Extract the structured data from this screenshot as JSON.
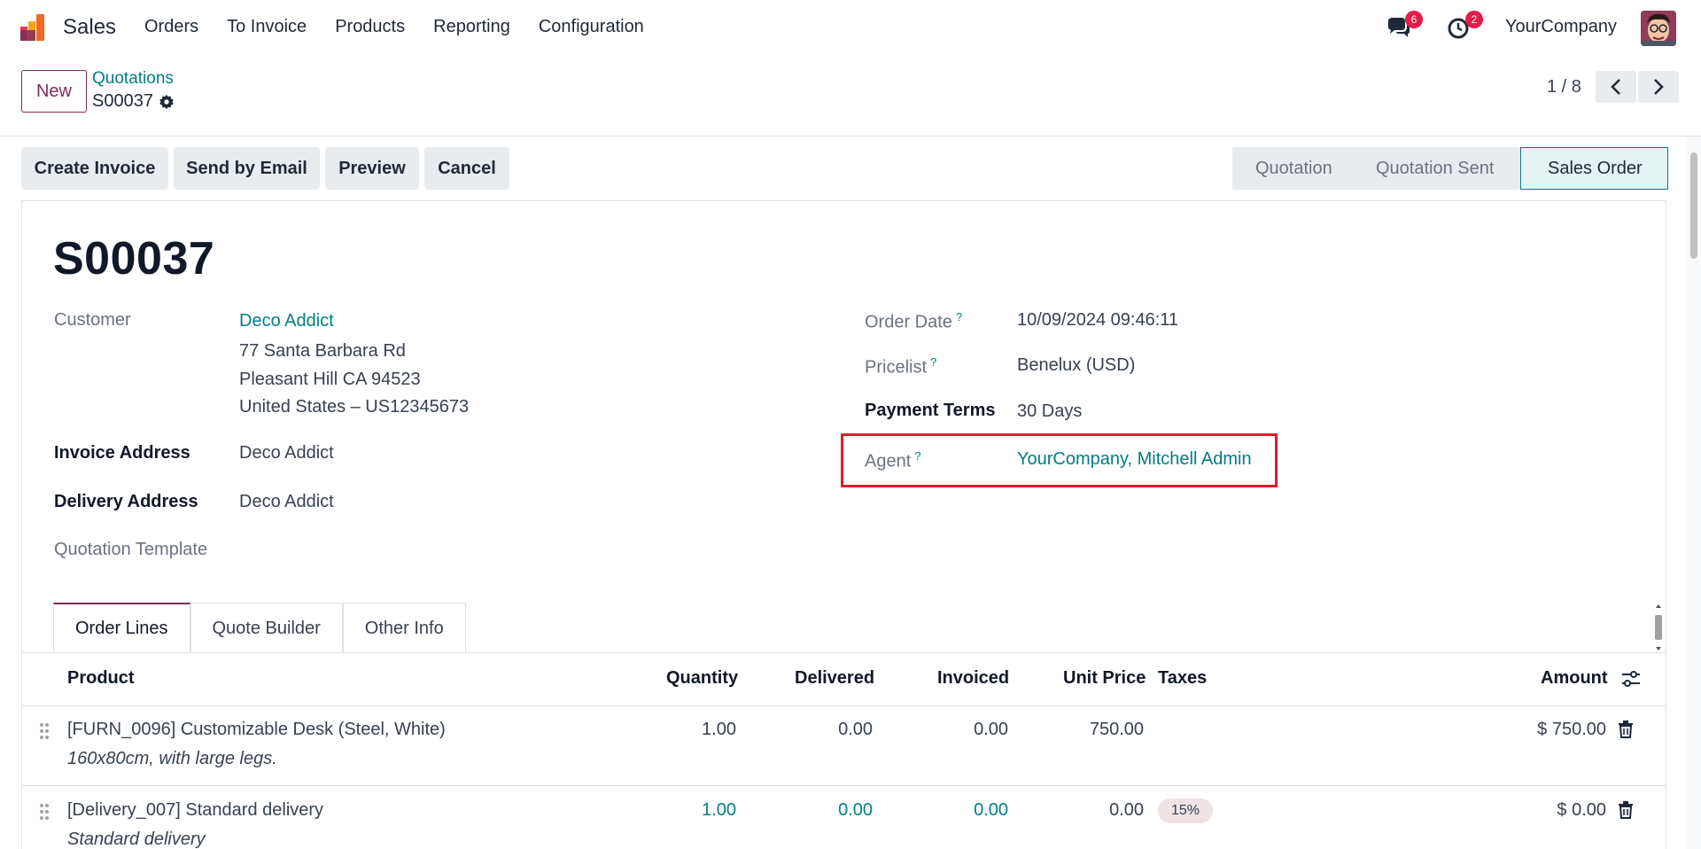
{
  "navbar": {
    "app_name": "Sales",
    "menu": [
      "Orders",
      "To Invoice",
      "Products",
      "Reporting",
      "Configuration"
    ],
    "messages_count": "6",
    "activities_count": "2",
    "company": "YourCompany"
  },
  "control": {
    "new_label": "New",
    "breadcrumb_parent": "Quotations",
    "breadcrumb_current": "S00037",
    "pager": "1 / 8"
  },
  "actions": {
    "create_invoice": "Create Invoice",
    "send_email": "Send by Email",
    "preview": "Preview",
    "cancel": "Cancel"
  },
  "status": {
    "stages": [
      "Quotation",
      "Quotation Sent",
      "Sales Order"
    ],
    "active": "Sales Order"
  },
  "form": {
    "title": "S00037",
    "customer_label": "Customer",
    "customer_name": "Deco Addict",
    "customer_address_1": "77 Santa Barbara Rd",
    "customer_address_2": "Pleasant Hill CA 94523",
    "customer_address_3": "United States – US12345673",
    "invoice_address_label": "Invoice Address",
    "invoice_address": "Deco Addict",
    "delivery_address_label": "Delivery Address",
    "delivery_address": "Deco Addict",
    "quotation_template_label": "Quotation Template",
    "order_date_label": "Order Date",
    "order_date": "10/09/2024 09:46:11",
    "pricelist_label": "Pricelist",
    "pricelist": "Benelux (USD)",
    "payment_terms_label": "Payment Terms",
    "payment_terms": "30 Days",
    "agent_label": "Agent",
    "agent": "YourCompany, Mitchell Admin",
    "help_mark": "?"
  },
  "tabs": [
    "Order Lines",
    "Quote Builder",
    "Other Info"
  ],
  "table": {
    "headers": {
      "product": "Product",
      "quantity": "Quantity",
      "delivered": "Delivered",
      "invoiced": "Invoiced",
      "unit_price": "Unit Price",
      "taxes": "Taxes",
      "amount": "Amount"
    },
    "rows": [
      {
        "product": "[FURN_0096] Customizable Desk (Steel, White)",
        "description": "160x80cm, with large legs.",
        "quantity": "1.00",
        "delivered": "0.00",
        "invoiced": "0.00",
        "unit_price": "750.00",
        "taxes": "",
        "amount": "$ 750.00"
      },
      {
        "product": "[Delivery_007] Standard delivery",
        "description": "Standard delivery",
        "quantity": "1.00",
        "delivered": "0.00",
        "invoiced": "0.00",
        "unit_price": "0.00",
        "taxes": "15%",
        "amount": "$ 0.00"
      }
    ]
  },
  "colors": {
    "brand": "#7c2b57",
    "link": "#017e84",
    "highlight": "#e11d2a",
    "badge": "#e11d48"
  }
}
